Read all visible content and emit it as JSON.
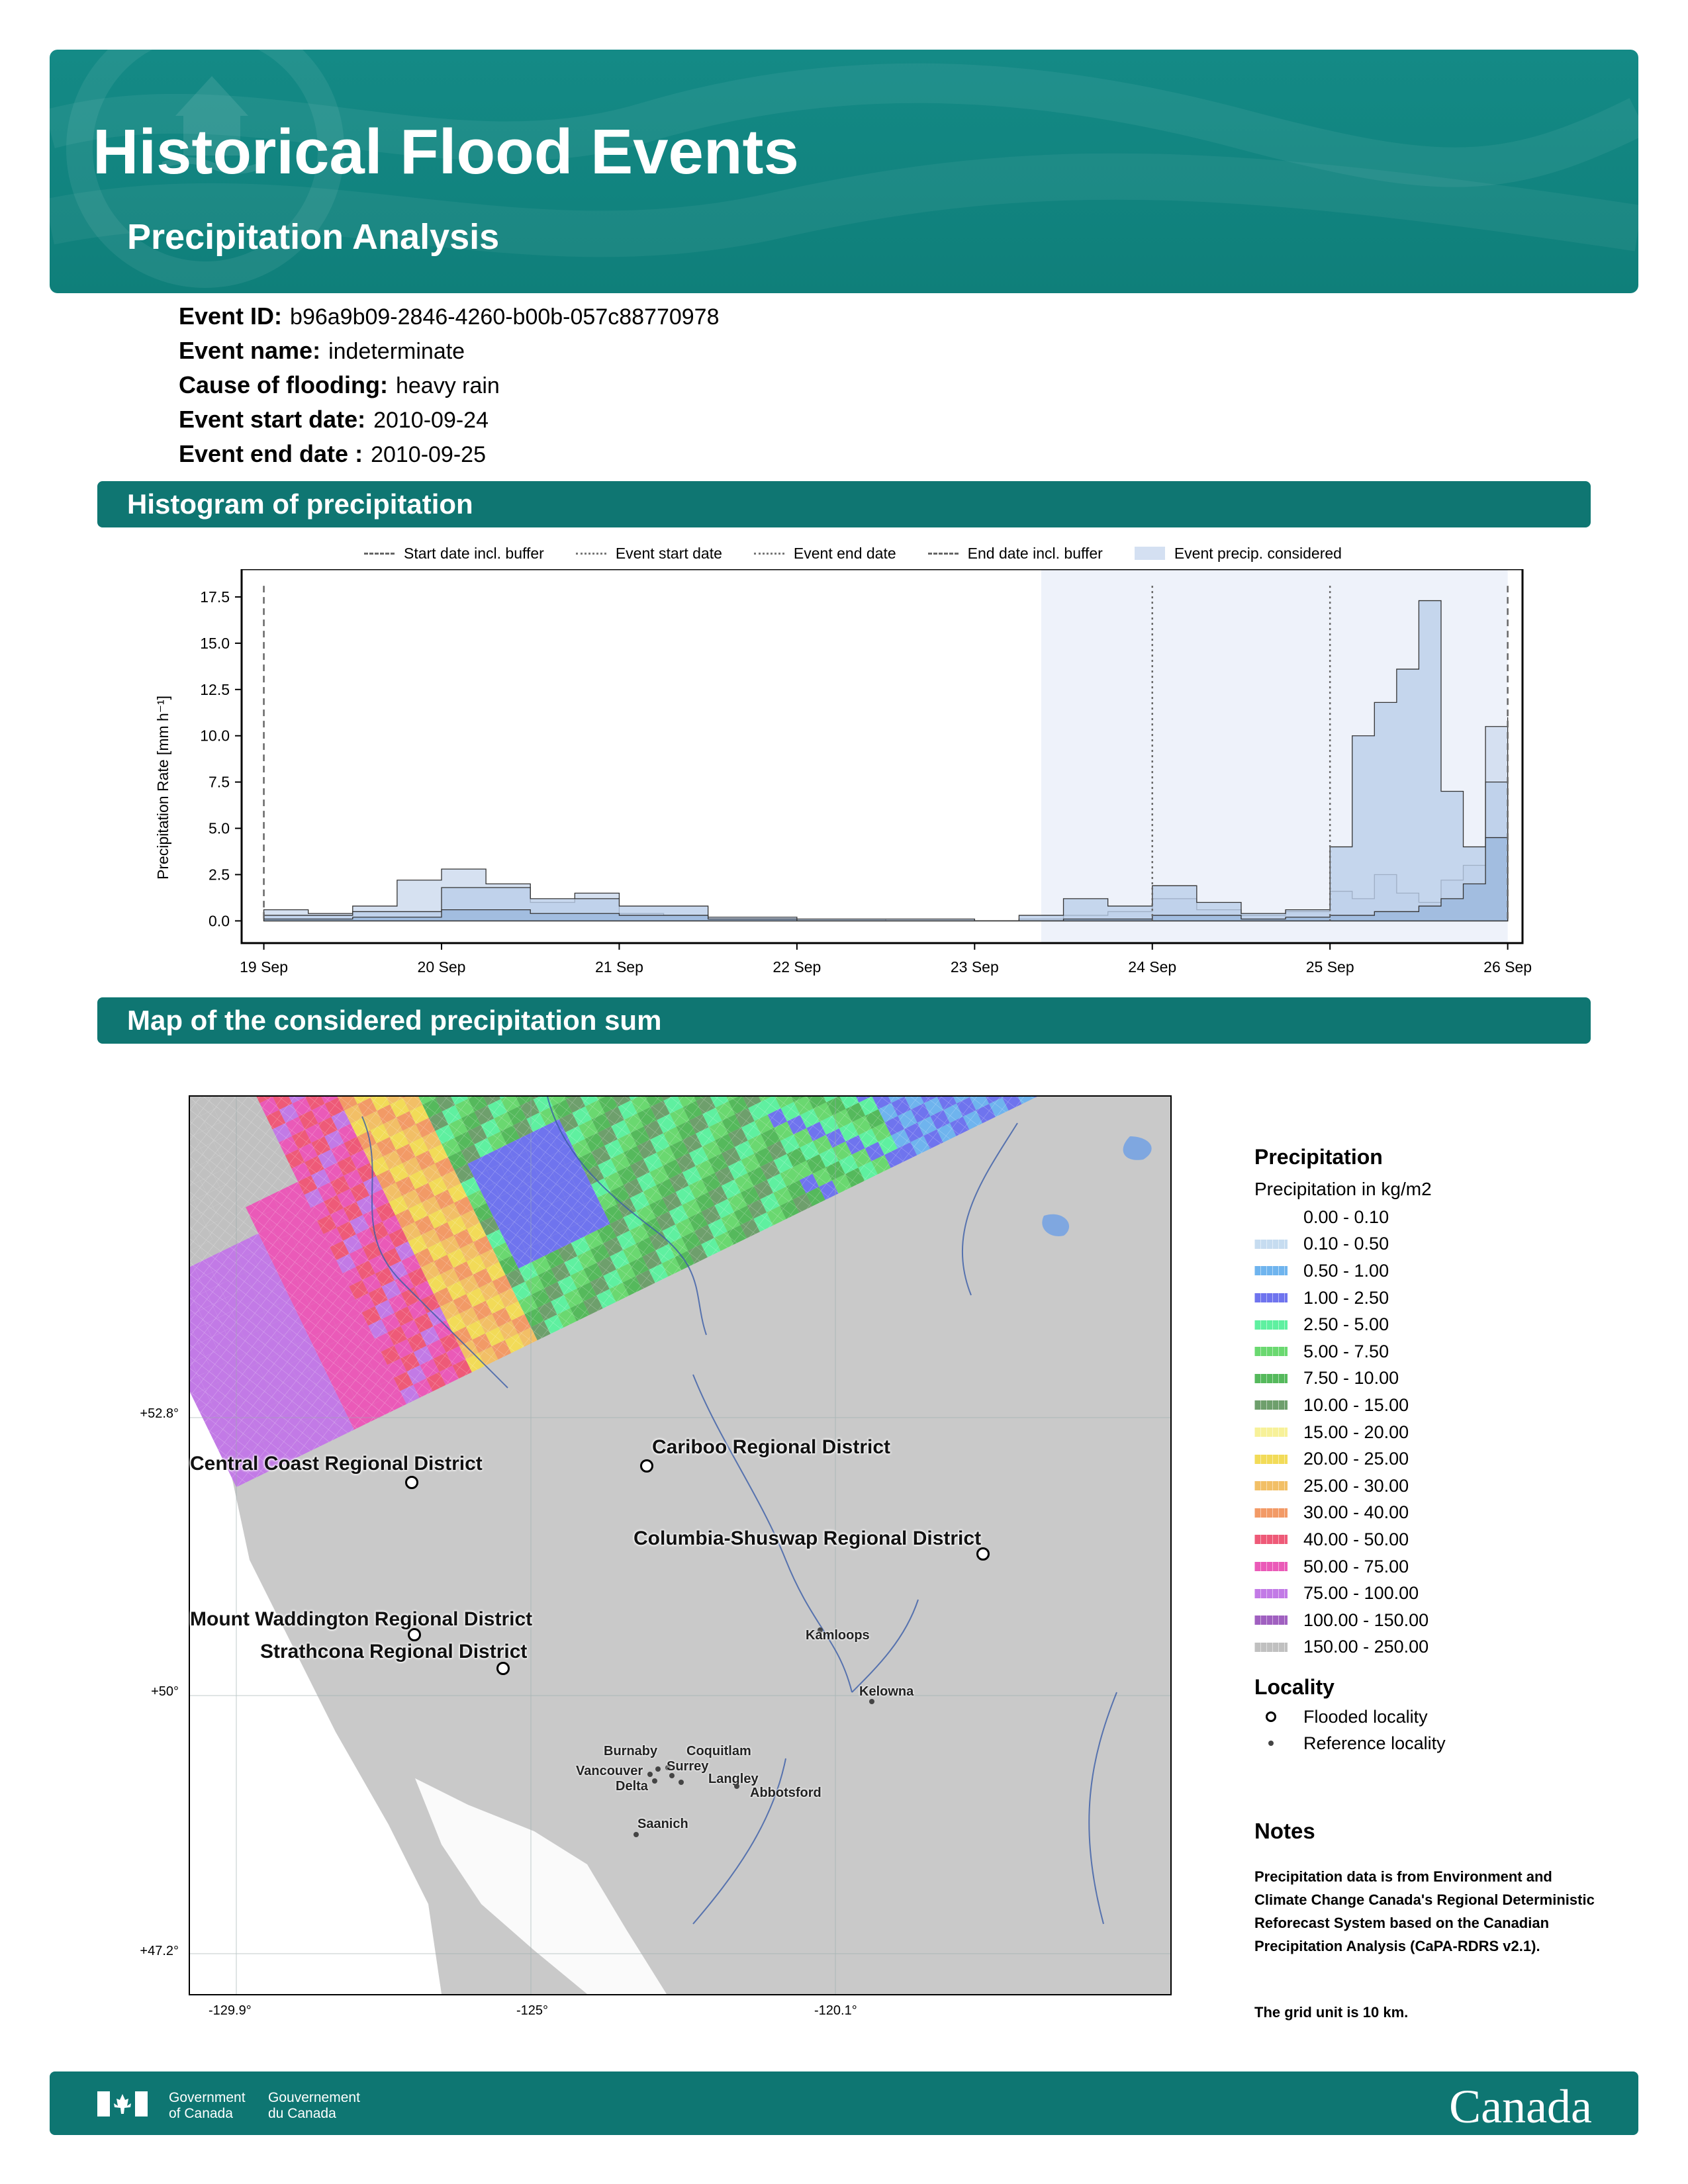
{
  "header": {
    "title": "Historical Flood Events",
    "subtitle": "Precipitation Analysis",
    "colors": {
      "banner": "#148a86",
      "section_bar": "#0f7672"
    }
  },
  "event": {
    "id_label": "Event ID:",
    "id": "b96a9b09-2846-4260-b00b-057c88770978",
    "name_label": "Event name:",
    "name": "indeterminate",
    "cause_label": "Cause of flooding:",
    "cause": "heavy rain",
    "start_label": "Event start date:",
    "start": "2010-09-24",
    "end_label": "Event end date :",
    "end": "2010-09-25"
  },
  "sections": {
    "histogram": "Histogram of precipitation",
    "map": "Map of the considered precipitation sum"
  },
  "chart_legend": {
    "start_buffer": "Start date incl. buffer",
    "event_start": "Event start date",
    "event_end": "Event end date",
    "end_buffer": "End date incl. buffer",
    "considered": "Event precip. considered"
  },
  "chart_data": {
    "type": "area",
    "ylabel": "Precipitation Rate [mm h⁻¹]",
    "xlabel": "",
    "ylim": [
      -1.2,
      19.0
    ],
    "xlim": [
      "2010-09-18T21:00",
      "2010-09-26T02:00"
    ],
    "yticks": [
      0.0,
      2.5,
      5.0,
      7.5,
      10.0,
      12.5,
      15.0,
      17.5
    ],
    "ytick_labels": [
      "0.0",
      "2.5",
      "5.0",
      "7.5",
      "10.0",
      "12.5",
      "15.0",
      "17.5"
    ],
    "xticks": [
      "2010-09-19",
      "2010-09-20",
      "2010-09-21",
      "2010-09-22",
      "2010-09-23",
      "2010-09-24",
      "2010-09-25",
      "2010-09-26"
    ],
    "xtick_labels": [
      "19 Sep",
      "20 Sep",
      "21 Sep",
      "22 Sep",
      "23 Sep",
      "24 Sep",
      "25 Sep",
      "26 Sep"
    ],
    "vlines": [
      {
        "kind": "start_buffer",
        "x": "2010-09-19"
      },
      {
        "kind": "event_start",
        "x": "2010-09-24"
      },
      {
        "kind": "event_end",
        "x": "2010-09-25"
      },
      {
        "kind": "end_buffer",
        "x": "2010-09-26"
      }
    ],
    "considered_range": [
      "2010-09-23T09:00",
      "2010-09-26"
    ],
    "grid": false,
    "legend_position": "top",
    "series": [
      {
        "x": [
          "2010-09-19T00:00",
          "2010-09-19T06:00",
          "2010-09-19T12:00",
          "2010-09-19T18:00",
          "2010-09-20T00:00",
          "2010-09-20T06:00",
          "2010-09-20T12:00",
          "2010-09-20T18:00",
          "2010-09-21T00:00",
          "2010-09-21T06:00",
          "2010-09-21T12:00",
          "2010-09-21T18:00",
          "2010-09-22T00:00",
          "2010-09-22T12:00",
          "2010-09-23T00:00",
          "2010-09-23T06:00",
          "2010-09-23T12:00",
          "2010-09-23T18:00",
          "2010-09-24T00:00",
          "2010-09-24T06:00",
          "2010-09-24T12:00",
          "2010-09-24T18:00",
          "2010-09-25T00:00",
          "2010-09-25T03:00",
          "2010-09-25T06:00",
          "2010-09-25T09:00",
          "2010-09-25T12:00",
          "2010-09-25T15:00",
          "2010-09-25T18:00",
          "2010-09-25T21:00",
          "2010-09-26T00:00"
        ],
        "y": [
          0.6,
          0.4,
          0.8,
          2.2,
          2.8,
          2.0,
          1.0,
          1.5,
          0.4,
          0.3,
          0.1,
          0.1,
          0.1,
          0.0,
          0.0,
          0.1,
          0.3,
          0.5,
          1.2,
          0.6,
          0.3,
          0.5,
          1.6,
          1.2,
          2.5,
          1.5,
          1.0,
          2.2,
          3.0,
          10.5,
          11.0
        ]
      },
      {
        "x": [
          "2010-09-19T00:00",
          "2010-09-19T12:00",
          "2010-09-20T00:00",
          "2010-09-20T12:00",
          "2010-09-21T00:00",
          "2010-09-21T12:00",
          "2010-09-22T00:00",
          "2010-09-22T12:00",
          "2010-09-23T00:00",
          "2010-09-23T06:00",
          "2010-09-23T12:00",
          "2010-09-23T18:00",
          "2010-09-24T00:00",
          "2010-09-24T06:00",
          "2010-09-24T12:00",
          "2010-09-24T18:00",
          "2010-09-25T00:00",
          "2010-09-25T03:00",
          "2010-09-25T06:00",
          "2010-09-25T09:00",
          "2010-09-25T12:00",
          "2010-09-25T15:00",
          "2010-09-25T18:00",
          "2010-09-25T21:00",
          "2010-09-26T00:00"
        ],
        "y": [
          0.3,
          0.5,
          1.8,
          1.2,
          0.8,
          0.2,
          0.1,
          0.1,
          0.0,
          0.3,
          1.2,
          0.8,
          1.9,
          1.0,
          0.4,
          0.6,
          4.0,
          10.0,
          11.8,
          13.6,
          17.3,
          7.0,
          4.0,
          7.5,
          6.8
        ]
      },
      {
        "x": [
          "2010-09-19T00:00",
          "2010-09-19T12:00",
          "2010-09-20T00:00",
          "2010-09-20T12:00",
          "2010-09-21T00:00",
          "2010-09-21T12:00",
          "2010-09-22T00:00",
          "2010-09-22T12:00",
          "2010-09-23T00:00",
          "2010-09-23T12:00",
          "2010-09-24T00:00",
          "2010-09-24T12:00",
          "2010-09-24T18:00",
          "2010-09-25T00:00",
          "2010-09-25T06:00",
          "2010-09-25T12:00",
          "2010-09-25T15:00",
          "2010-09-25T18:00",
          "2010-09-25T21:00",
          "2010-09-26T00:00"
        ],
        "y": [
          0.1,
          0.2,
          0.6,
          0.4,
          0.3,
          0.1,
          0.0,
          0.0,
          0.0,
          0.1,
          0.3,
          0.1,
          0.2,
          0.3,
          0.5,
          0.8,
          1.2,
          2.0,
          4.5,
          5.0
        ]
      }
    ]
  },
  "map": {
    "lat_labels": [
      "+52.8°",
      "+50°",
      "+47.2°"
    ],
    "lon_labels": [
      "-129.9°",
      "-125°",
      "-120.1°"
    ],
    "flooded": [
      "Central Coast Regional District",
      "Cariboo Regional District",
      "Columbia-Shuswap Regional District",
      "Mount Waddington Regional District",
      "Strathcona Regional District"
    ],
    "reference": [
      "Kamloops",
      "Kelowna",
      "Burnaby",
      "Coquitlam",
      "Surrey",
      "Vancouver",
      "Delta",
      "Langley",
      "Abbotsford",
      "Saanich"
    ]
  },
  "precip_legend": {
    "title": "Precipitation",
    "subtitle": "Precipitation in kg/m2",
    "bins": [
      {
        "label": "0.00 - 0.10",
        "color": "#ffffff"
      },
      {
        "label": "0.10 - 0.50",
        "color": "#c6dcf0"
      },
      {
        "label": "0.50 - 1.00",
        "color": "#6fb4ee"
      },
      {
        "label": "1.00 - 2.50",
        "color": "#6f74ee"
      },
      {
        "label": "2.50 - 5.00",
        "color": "#5ff0a0"
      },
      {
        "label": "5.00 - 7.50",
        "color": "#6ad870"
      },
      {
        "label": "7.50 - 10.00",
        "color": "#55b95c"
      },
      {
        "label": "10.00 - 15.00",
        "color": "#6e9f6c"
      },
      {
        "label": "15.00 - 20.00",
        "color": "#f7f199"
      },
      {
        "label": "20.00 - 25.00",
        "color": "#f2db58"
      },
      {
        "label": "25.00 - 30.00",
        "color": "#f2bf66"
      },
      {
        "label": "30.00 - 40.00",
        "color": "#f29a66"
      },
      {
        "label": "40.00 - 50.00",
        "color": "#ee5a78"
      },
      {
        "label": "50.00 - 75.00",
        "color": "#ea5ab8"
      },
      {
        "label": "75.00 - 100.00",
        "color": "#c27ae6"
      },
      {
        "label": "100.00 - 150.00",
        "color": "#a060c0"
      },
      {
        "label": "150.00 - 250.00",
        "color": "#c0c0c0"
      }
    ],
    "locality_title": "Locality",
    "flooded_label": "Flooded locality",
    "reference_label": "Reference locality"
  },
  "notes": {
    "title": "Notes",
    "text": "Precipitation data is from Environment and Climate Change Canada's Regional Deterministic Reforecast System based on the Canadian Precipitation Analysis (CaPA-RDRS v2.1).",
    "grid": "The grid unit is 10 km."
  },
  "footer": {
    "gov_en_1": "Government",
    "gov_en_2": "of Canada",
    "gov_fr_1": "Gouvernement",
    "gov_fr_2": "du Canada",
    "wordmark": "Canada"
  }
}
